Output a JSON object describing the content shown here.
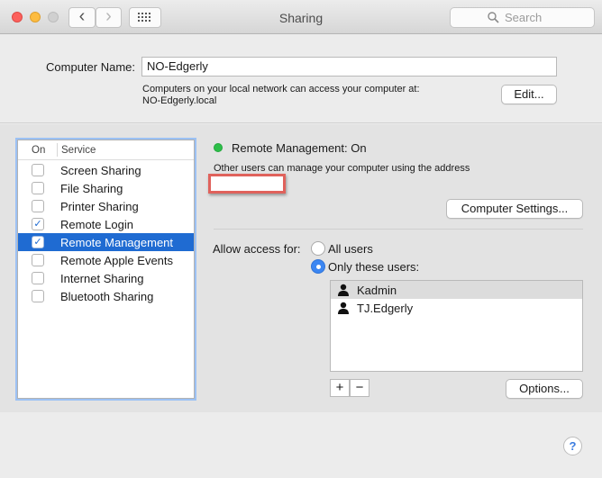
{
  "window": {
    "title": "Sharing",
    "back_icon": "‹",
    "forward_icon": "›",
    "grid_icon": "grid-icon",
    "search_placeholder": "Search"
  },
  "computer": {
    "label": "Computer Name:",
    "name": "NO-Edgerly",
    "info_line1": "Computers on your local network can access your computer at:",
    "info_line2": "NO-Edgerly.local",
    "edit_label": "Edit..."
  },
  "services": {
    "header_on": "On",
    "header_service": "Service",
    "items": [
      {
        "label": "Screen Sharing",
        "checked": false,
        "selected": false
      },
      {
        "label": "File Sharing",
        "checked": false,
        "selected": false
      },
      {
        "label": "Printer Sharing",
        "checked": false,
        "selected": false
      },
      {
        "label": "Remote Login",
        "checked": true,
        "selected": false
      },
      {
        "label": "Remote Management",
        "checked": true,
        "selected": true
      },
      {
        "label": "Remote Apple Events",
        "checked": false,
        "selected": false
      },
      {
        "label": "Internet Sharing",
        "checked": false,
        "selected": false
      },
      {
        "label": "Bluetooth Sharing",
        "checked": false,
        "selected": false
      }
    ]
  },
  "detail": {
    "status": "Remote Management: On",
    "status_color": "#2dbf49",
    "description": "Other users can manage your computer using the address",
    "computer_settings_label": "Computer Settings...",
    "allow_access_label": "Allow access for:",
    "radio_all": "All users",
    "radio_only": "Only these users:",
    "selected_radio": "only",
    "users": [
      {
        "name": "Kadmin",
        "selected": true
      },
      {
        "name": "TJ.Edgerly",
        "selected": false
      }
    ],
    "add_label": "+",
    "remove_label": "−",
    "options_label": "Options..."
  },
  "help_label": "?"
}
